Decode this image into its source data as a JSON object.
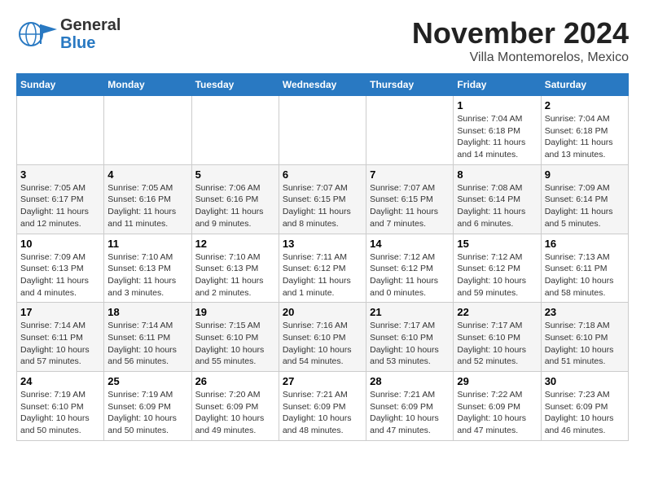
{
  "header": {
    "logo_general": "General",
    "logo_blue": "Blue",
    "month": "November 2024",
    "location": "Villa Montemorelos, Mexico"
  },
  "weekdays": [
    "Sunday",
    "Monday",
    "Tuesday",
    "Wednesday",
    "Thursday",
    "Friday",
    "Saturday"
  ],
  "weeks": [
    [
      {
        "day": "",
        "info": ""
      },
      {
        "day": "",
        "info": ""
      },
      {
        "day": "",
        "info": ""
      },
      {
        "day": "",
        "info": ""
      },
      {
        "day": "",
        "info": ""
      },
      {
        "day": "1",
        "info": "Sunrise: 7:04 AM\nSunset: 6:18 PM\nDaylight: 11 hours and 14 minutes."
      },
      {
        "day": "2",
        "info": "Sunrise: 7:04 AM\nSunset: 6:18 PM\nDaylight: 11 hours and 13 minutes."
      }
    ],
    [
      {
        "day": "3",
        "info": "Sunrise: 7:05 AM\nSunset: 6:17 PM\nDaylight: 11 hours and 12 minutes."
      },
      {
        "day": "4",
        "info": "Sunrise: 7:05 AM\nSunset: 6:16 PM\nDaylight: 11 hours and 11 minutes."
      },
      {
        "day": "5",
        "info": "Sunrise: 7:06 AM\nSunset: 6:16 PM\nDaylight: 11 hours and 9 minutes."
      },
      {
        "day": "6",
        "info": "Sunrise: 7:07 AM\nSunset: 6:15 PM\nDaylight: 11 hours and 8 minutes."
      },
      {
        "day": "7",
        "info": "Sunrise: 7:07 AM\nSunset: 6:15 PM\nDaylight: 11 hours and 7 minutes."
      },
      {
        "day": "8",
        "info": "Sunrise: 7:08 AM\nSunset: 6:14 PM\nDaylight: 11 hours and 6 minutes."
      },
      {
        "day": "9",
        "info": "Sunrise: 7:09 AM\nSunset: 6:14 PM\nDaylight: 11 hours and 5 minutes."
      }
    ],
    [
      {
        "day": "10",
        "info": "Sunrise: 7:09 AM\nSunset: 6:13 PM\nDaylight: 11 hours and 4 minutes."
      },
      {
        "day": "11",
        "info": "Sunrise: 7:10 AM\nSunset: 6:13 PM\nDaylight: 11 hours and 3 minutes."
      },
      {
        "day": "12",
        "info": "Sunrise: 7:10 AM\nSunset: 6:13 PM\nDaylight: 11 hours and 2 minutes."
      },
      {
        "day": "13",
        "info": "Sunrise: 7:11 AM\nSunset: 6:12 PM\nDaylight: 11 hours and 1 minute."
      },
      {
        "day": "14",
        "info": "Sunrise: 7:12 AM\nSunset: 6:12 PM\nDaylight: 11 hours and 0 minutes."
      },
      {
        "day": "15",
        "info": "Sunrise: 7:12 AM\nSunset: 6:12 PM\nDaylight: 10 hours and 59 minutes."
      },
      {
        "day": "16",
        "info": "Sunrise: 7:13 AM\nSunset: 6:11 PM\nDaylight: 10 hours and 58 minutes."
      }
    ],
    [
      {
        "day": "17",
        "info": "Sunrise: 7:14 AM\nSunset: 6:11 PM\nDaylight: 10 hours and 57 minutes."
      },
      {
        "day": "18",
        "info": "Sunrise: 7:14 AM\nSunset: 6:11 PM\nDaylight: 10 hours and 56 minutes."
      },
      {
        "day": "19",
        "info": "Sunrise: 7:15 AM\nSunset: 6:10 PM\nDaylight: 10 hours and 55 minutes."
      },
      {
        "day": "20",
        "info": "Sunrise: 7:16 AM\nSunset: 6:10 PM\nDaylight: 10 hours and 54 minutes."
      },
      {
        "day": "21",
        "info": "Sunrise: 7:17 AM\nSunset: 6:10 PM\nDaylight: 10 hours and 53 minutes."
      },
      {
        "day": "22",
        "info": "Sunrise: 7:17 AM\nSunset: 6:10 PM\nDaylight: 10 hours and 52 minutes."
      },
      {
        "day": "23",
        "info": "Sunrise: 7:18 AM\nSunset: 6:10 PM\nDaylight: 10 hours and 51 minutes."
      }
    ],
    [
      {
        "day": "24",
        "info": "Sunrise: 7:19 AM\nSunset: 6:10 PM\nDaylight: 10 hours and 50 minutes."
      },
      {
        "day": "25",
        "info": "Sunrise: 7:19 AM\nSunset: 6:09 PM\nDaylight: 10 hours and 50 minutes."
      },
      {
        "day": "26",
        "info": "Sunrise: 7:20 AM\nSunset: 6:09 PM\nDaylight: 10 hours and 49 minutes."
      },
      {
        "day": "27",
        "info": "Sunrise: 7:21 AM\nSunset: 6:09 PM\nDaylight: 10 hours and 48 minutes."
      },
      {
        "day": "28",
        "info": "Sunrise: 7:21 AM\nSunset: 6:09 PM\nDaylight: 10 hours and 47 minutes."
      },
      {
        "day": "29",
        "info": "Sunrise: 7:22 AM\nSunset: 6:09 PM\nDaylight: 10 hours and 47 minutes."
      },
      {
        "day": "30",
        "info": "Sunrise: 7:23 AM\nSunset: 6:09 PM\nDaylight: 10 hours and 46 minutes."
      }
    ]
  ]
}
